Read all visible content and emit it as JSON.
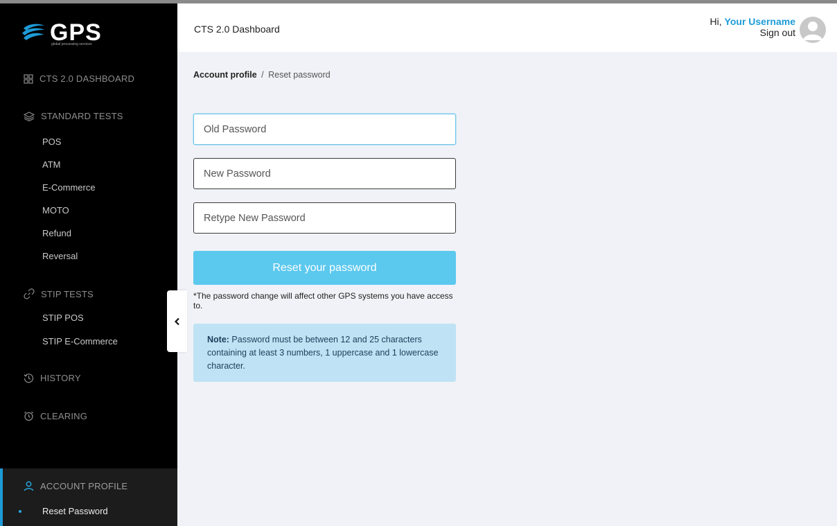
{
  "brand": {
    "name": "GPS",
    "tagline": "global processing services"
  },
  "sidebar": {
    "dashboard_label": "CTS 2.0 DASHBOARD",
    "standard_tests": {
      "label": "STANDARD TESTS",
      "items": [
        "POS",
        "ATM",
        "E-Commerce",
        "MOTO",
        "Refund",
        "Reversal"
      ]
    },
    "stip_tests": {
      "label": "STIP TESTS",
      "items": [
        "STIP POS",
        "STIP E-Commerce"
      ]
    },
    "history_label": "HISTORY",
    "clearing_label": "CLEARING",
    "account_profile": {
      "label": "ACCOUNT PROFILE",
      "items": [
        "Reset Password"
      ]
    }
  },
  "header": {
    "title": "CTS 2.0 Dashboard",
    "greeting": "Hi,",
    "username": "Your Username",
    "sign_out": "Sign out"
  },
  "breadcrumb": {
    "root": "Account profile",
    "separator": "/",
    "current": "Reset password"
  },
  "form": {
    "old_password_placeholder": "Old Password",
    "new_password_placeholder": "New Password",
    "retype_password_placeholder": "Retype New Password",
    "submit_label": "Reset your password",
    "hint": "*The password change will affect other GPS systems you have access to.",
    "note_label": "Note:",
    "note_text": " Password must be between 12 and 25 characters containing at least 3 numbers, 1 uppercase and 1 lowercase character."
  },
  "colors": {
    "accent": "#1e9bd7",
    "button": "#5bc8ee",
    "note_bg": "#bfe3f4",
    "sidebar_bg": "#000000"
  },
  "icons": {
    "dashboard": "grid-icon",
    "standard_tests": "layers-icon",
    "stip_tests": "link-icon",
    "history": "history-icon",
    "clearing": "alarm-clock-icon",
    "account": "user-icon",
    "collapse": "chevron-left-icon",
    "avatar": "avatar-icon"
  }
}
